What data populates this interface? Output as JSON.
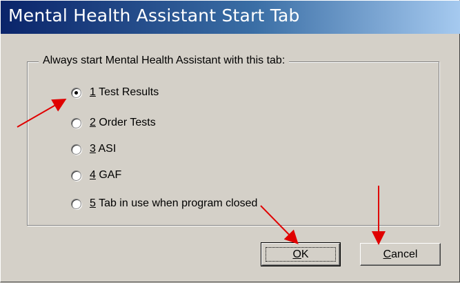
{
  "dialog": {
    "title": "Mental Health Assistant Start Tab",
    "group_label": "Always start Mental Health Assistant with this tab:",
    "options": [
      {
        "num": "1",
        "label": " Test Results",
        "selected": true
      },
      {
        "num": "2",
        "label": " Order Tests",
        "selected": false
      },
      {
        "num": "3",
        "label": " ASI",
        "selected": false
      },
      {
        "num": "4",
        "label": " GAF",
        "selected": false
      },
      {
        "num": "5",
        "label": " Tab in use when program closed",
        "selected": false
      }
    ],
    "ok": {
      "mnemonic": "O",
      "rest": "K"
    },
    "cancel": {
      "mnemonic": "C",
      "rest": "ancel"
    }
  },
  "colors": {
    "annotation_arrow": "#e00000"
  }
}
